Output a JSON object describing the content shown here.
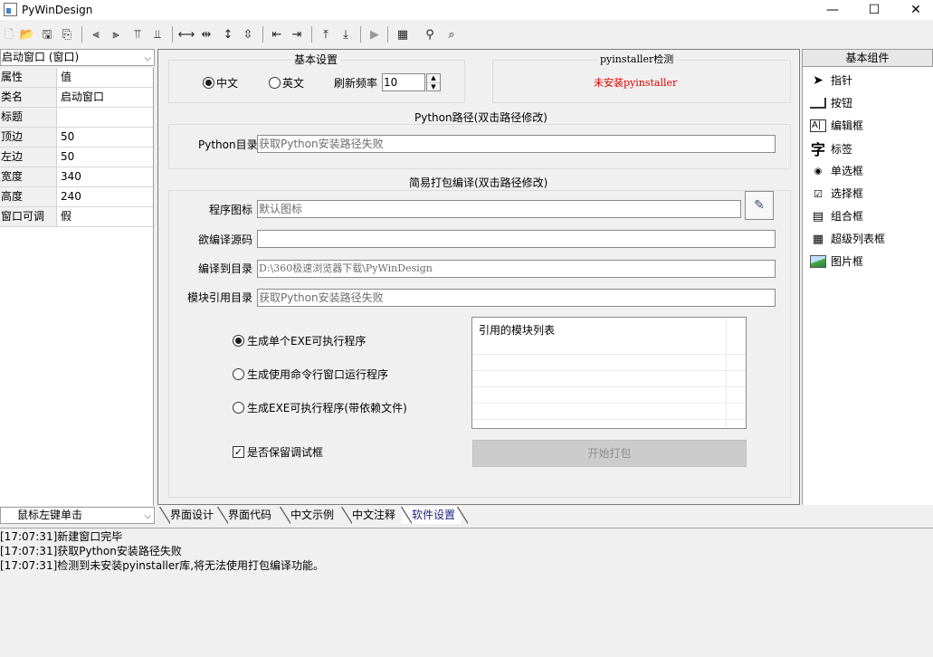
{
  "window": {
    "title": "PyWinDesign",
    "minimize": "—",
    "maximize": "☐",
    "close": "✕"
  },
  "toolbar": {
    "icons": [
      "new-file-icon",
      "open-folder-icon",
      "save-icon",
      "save-as-icon",
      "align-left-icon",
      "align-center-icon",
      "align-top-icon",
      "align-middle-icon",
      "same-width-icon",
      "h-space-icon",
      "same-height-icon",
      "v-space-icon",
      "h-increase-icon",
      "h-decrease-icon",
      "v-increase-icon",
      "v-decrease-icon",
      "run-icon",
      "window-layout-icon",
      "find-icon",
      "inspect-icon"
    ]
  },
  "left_panel": {
    "object_selector": "启动窗口 (窗口)",
    "header_key": "属性",
    "header_value": "值",
    "properties": [
      {
        "key": "类名",
        "value": "启动窗口"
      },
      {
        "key": "标题",
        "value": ""
      },
      {
        "key": "顶边",
        "value": "50"
      },
      {
        "key": "左边",
        "value": "50"
      },
      {
        "key": "宽度",
        "value": "340"
      },
      {
        "key": "高度",
        "value": "240"
      },
      {
        "key": "窗口可调",
        "value": "假"
      }
    ],
    "event_selector": "鼠标左键单击"
  },
  "settings": {
    "basic_group": "基本设置",
    "lang_chinese": "中文",
    "lang_english": "英文",
    "refresh_label": "刷新频率",
    "refresh_value": "10",
    "pyinstaller_group": "pyinstaller检测",
    "pyinstaller_status": "未安装pyinstaller",
    "python_group": "Python路径(双击路径修改)",
    "python_dir_label": "Python目录",
    "python_dir_value": "获取Python安装路径失败",
    "pack_group": "简易打包编译(双击路径修改)",
    "icon_label": "程序图标",
    "icon_value": "默认图标",
    "source_label": "欲编译源码",
    "source_value": "",
    "output_label": "编译到目录",
    "output_value": "D:\\360极速浏览器下载\\PyWinDesign",
    "module_label": "模块引用目录",
    "module_value": "获取Python安装路径失败",
    "option_single_exe": "生成单个EXE可执行程序",
    "option_console": "生成使用命令行窗口运行程序",
    "option_with_deps": "生成EXE可执行程序(带依赖文件)",
    "module_list_header": "引用的模块列表",
    "keep_debug": "是否保留调试框",
    "start_pack": "开始打包"
  },
  "palette": {
    "title": "基本组件",
    "items": [
      {
        "label": "指针",
        "icon": "pointer-icon"
      },
      {
        "label": "按钮",
        "icon": "button-icon"
      },
      {
        "label": "编辑框",
        "icon": "edit-box-icon"
      },
      {
        "label": "标签",
        "icon": "label-icon"
      },
      {
        "label": "单选框",
        "icon": "radio-icon"
      },
      {
        "label": "选择框",
        "icon": "checkbox-icon"
      },
      {
        "label": "组合框",
        "icon": "combobox-icon"
      },
      {
        "label": "超级列表框",
        "icon": "listview-icon"
      },
      {
        "label": "图片框",
        "icon": "picture-icon"
      }
    ]
  },
  "tabs": [
    "界面设计",
    "界面代码",
    "中文示例",
    "中文注释",
    "软件设置"
  ],
  "active_tab": "软件设置",
  "log": [
    "[17:07:31]新建窗口完毕",
    "[17:07:31]获取Python安装路径失败",
    "[17:07:31]检测到未安装pyinstaller库,将无法使用打包编译功能。"
  ],
  "colors": {
    "accent_blue": "#0078d7",
    "error_red": "#e00000",
    "active_tab_text": "#1a237e"
  }
}
